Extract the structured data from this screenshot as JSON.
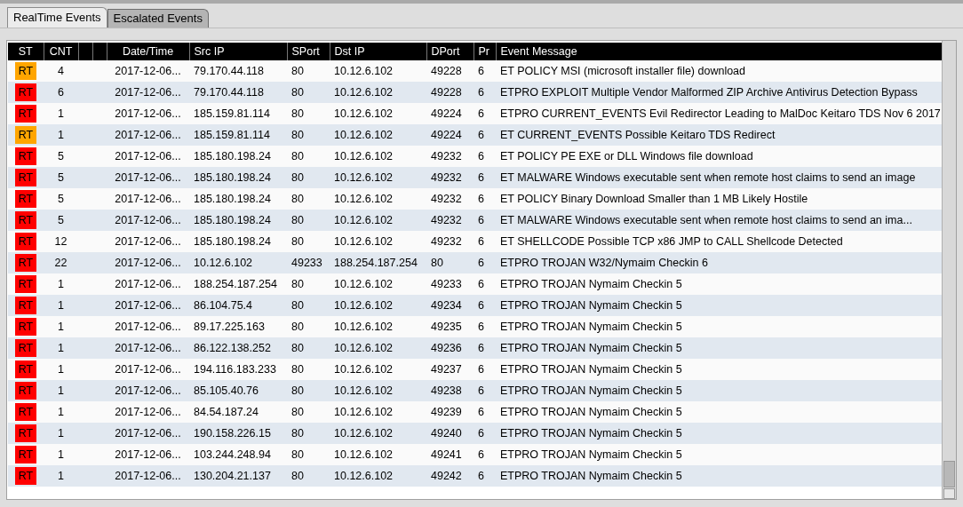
{
  "tabs": [
    {
      "label": "RealTime Events",
      "selected": true
    },
    {
      "label": "Escalated Events",
      "selected": false
    }
  ],
  "table": {
    "columns": [
      "ST",
      "CNT",
      "Date/Time",
      "Src IP",
      "SPort",
      "Dst IP",
      "DPort",
      "Pr",
      "Event Message"
    ],
    "rows": [
      {
        "st": "RT",
        "color": "#ffa500",
        "cnt": "4",
        "datetime": "2017-12-06...",
        "src_ip": "79.170.44.118",
        "sport": "80",
        "dst_ip": "10.12.6.102",
        "dport": "49228",
        "pr": "6",
        "message": "ET POLICY MSI (microsoft installer file) download"
      },
      {
        "st": "RT",
        "color": "#ff0000",
        "cnt": "6",
        "datetime": "2017-12-06...",
        "src_ip": "79.170.44.118",
        "sport": "80",
        "dst_ip": "10.12.6.102",
        "dport": "49228",
        "pr": "6",
        "message": "ETPRO EXPLOIT Multiple Vendor Malformed ZIP Archive Antivirus Detection Bypass"
      },
      {
        "st": "RT",
        "color": "#ff0000",
        "cnt": "1",
        "datetime": "2017-12-06...",
        "src_ip": "185.159.81.114",
        "sport": "80",
        "dst_ip": "10.12.6.102",
        "dport": "49224",
        "pr": "6",
        "message": "ETPRO CURRENT_EVENTS Evil Redirector Leading to MalDoc Keitaro TDS Nov 6 2017"
      },
      {
        "st": "RT",
        "color": "#ffa500",
        "cnt": "1",
        "datetime": "2017-12-06...",
        "src_ip": "185.159.81.114",
        "sport": "80",
        "dst_ip": "10.12.6.102",
        "dport": "49224",
        "pr": "6",
        "message": "ET CURRENT_EVENTS Possible Keitaro TDS Redirect"
      },
      {
        "st": "RT",
        "color": "#ff0000",
        "cnt": "5",
        "datetime": "2017-12-06...",
        "src_ip": "185.180.198.24",
        "sport": "80",
        "dst_ip": "10.12.6.102",
        "dport": "49232",
        "pr": "6",
        "message": "ET POLICY PE EXE or DLL Windows file download"
      },
      {
        "st": "RT",
        "color": "#ff0000",
        "cnt": "5",
        "datetime": "2017-12-06...",
        "src_ip": "185.180.198.24",
        "sport": "80",
        "dst_ip": "10.12.6.102",
        "dport": "49232",
        "pr": "6",
        "message": "ET MALWARE Windows executable sent when remote host claims to send an image"
      },
      {
        "st": "RT",
        "color": "#ff0000",
        "cnt": "5",
        "datetime": "2017-12-06...",
        "src_ip": "185.180.198.24",
        "sport": "80",
        "dst_ip": "10.12.6.102",
        "dport": "49232",
        "pr": "6",
        "message": "ET POLICY Binary Download Smaller than 1 MB Likely Hostile"
      },
      {
        "st": "RT",
        "color": "#ff0000",
        "cnt": "5",
        "datetime": "2017-12-06...",
        "src_ip": "185.180.198.24",
        "sport": "80",
        "dst_ip": "10.12.6.102",
        "dport": "49232",
        "pr": "6",
        "message": "ET MALWARE Windows executable sent when remote host claims to send an ima..."
      },
      {
        "st": "RT",
        "color": "#ff0000",
        "cnt": "12",
        "datetime": "2017-12-06...",
        "src_ip": "185.180.198.24",
        "sport": "80",
        "dst_ip": "10.12.6.102",
        "dport": "49232",
        "pr": "6",
        "message": "ET SHELLCODE Possible TCP x86 JMP to CALL Shellcode Detected"
      },
      {
        "st": "RT",
        "color": "#ff0000",
        "cnt": "22",
        "datetime": "2017-12-06...",
        "src_ip": "10.12.6.102",
        "sport": "49233",
        "dst_ip": "188.254.187.254",
        "dport": "80",
        "pr": "6",
        "message": "ETPRO TROJAN W32/Nymaim Checkin 6"
      },
      {
        "st": "RT",
        "color": "#ff0000",
        "cnt": "1",
        "datetime": "2017-12-06...",
        "src_ip": "188.254.187.254",
        "sport": "80",
        "dst_ip": "10.12.6.102",
        "dport": "49233",
        "pr": "6",
        "message": "ETPRO TROJAN Nymaim Checkin 5"
      },
      {
        "st": "RT",
        "color": "#ff0000",
        "cnt": "1",
        "datetime": "2017-12-06...",
        "src_ip": "86.104.75.4",
        "sport": "80",
        "dst_ip": "10.12.6.102",
        "dport": "49234",
        "pr": "6",
        "message": "ETPRO TROJAN Nymaim Checkin 5"
      },
      {
        "st": "RT",
        "color": "#ff0000",
        "cnt": "1",
        "datetime": "2017-12-06...",
        "src_ip": "89.17.225.163",
        "sport": "80",
        "dst_ip": "10.12.6.102",
        "dport": "49235",
        "pr": "6",
        "message": "ETPRO TROJAN Nymaim Checkin 5"
      },
      {
        "st": "RT",
        "color": "#ff0000",
        "cnt": "1",
        "datetime": "2017-12-06...",
        "src_ip": "86.122.138.252",
        "sport": "80",
        "dst_ip": "10.12.6.102",
        "dport": "49236",
        "pr": "6",
        "message": "ETPRO TROJAN Nymaim Checkin 5"
      },
      {
        "st": "RT",
        "color": "#ff0000",
        "cnt": "1",
        "datetime": "2017-12-06...",
        "src_ip": "194.116.183.233",
        "sport": "80",
        "dst_ip": "10.12.6.102",
        "dport": "49237",
        "pr": "6",
        "message": "ETPRO TROJAN Nymaim Checkin 5"
      },
      {
        "st": "RT",
        "color": "#ff0000",
        "cnt": "1",
        "datetime": "2017-12-06...",
        "src_ip": "85.105.40.76",
        "sport": "80",
        "dst_ip": "10.12.6.102",
        "dport": "49238",
        "pr": "6",
        "message": "ETPRO TROJAN Nymaim Checkin 5"
      },
      {
        "st": "RT",
        "color": "#ff0000",
        "cnt": "1",
        "datetime": "2017-12-06...",
        "src_ip": "84.54.187.24",
        "sport": "80",
        "dst_ip": "10.12.6.102",
        "dport": "49239",
        "pr": "6",
        "message": "ETPRO TROJAN Nymaim Checkin 5"
      },
      {
        "st": "RT",
        "color": "#ff0000",
        "cnt": "1",
        "datetime": "2017-12-06...",
        "src_ip": "190.158.226.15",
        "sport": "80",
        "dst_ip": "10.12.6.102",
        "dport": "49240",
        "pr": "6",
        "message": "ETPRO TROJAN Nymaim Checkin 5"
      },
      {
        "st": "RT",
        "color": "#ff0000",
        "cnt": "1",
        "datetime": "2017-12-06...",
        "src_ip": "103.244.248.94",
        "sport": "80",
        "dst_ip": "10.12.6.102",
        "dport": "49241",
        "pr": "6",
        "message": "ETPRO TROJAN Nymaim Checkin 5"
      },
      {
        "st": "RT",
        "color": "#ff0000",
        "cnt": "1",
        "datetime": "2017-12-06...",
        "src_ip": "130.204.21.137",
        "sport": "80",
        "dst_ip": "10.12.6.102",
        "dport": "49242",
        "pr": "6",
        "message": "ETPRO TROJAN Nymaim Checkin 5"
      }
    ]
  }
}
